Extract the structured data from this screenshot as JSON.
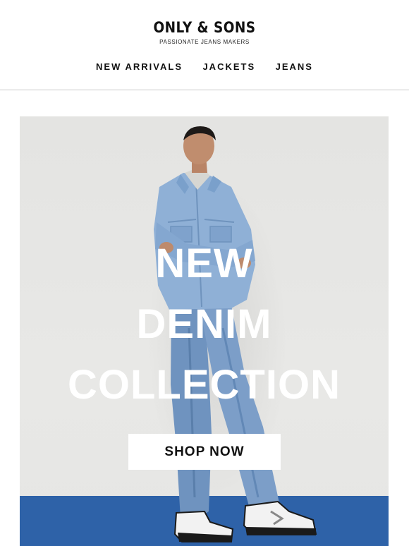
{
  "brand": {
    "name": "ONLY & SONS",
    "tagline": "PASSIONATE JEANS MAKERS"
  },
  "nav": {
    "items": [
      {
        "label": "NEW ARRIVALS"
      },
      {
        "label": "JACKETS"
      },
      {
        "label": "JEANS"
      }
    ]
  },
  "hero": {
    "headline_lines": [
      "NEW",
      "DENIM",
      "COLLECTION"
    ],
    "cta_label": "SHOP NOW",
    "image_subject": "man-in-denim-jacket-and-jeans"
  },
  "colors": {
    "background": "#ffffff",
    "hero_wall": "#e6e6e4",
    "hero_floor": "#2e62a8",
    "text": "#111111",
    "headline_text": "#ffffff",
    "divider": "#c8c8c8"
  }
}
